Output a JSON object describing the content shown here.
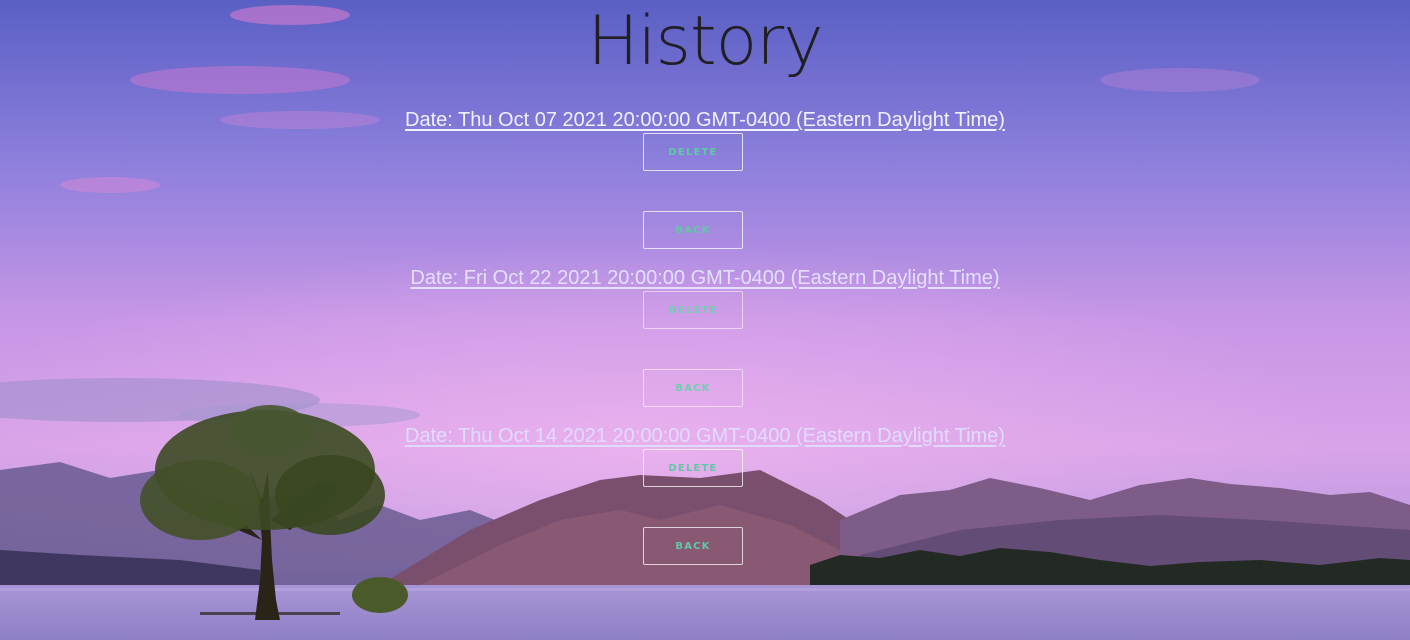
{
  "page": {
    "title": "History"
  },
  "entries": [
    {
      "date_text": "Date: Thu Oct 07 2021 20:00:00 GMT-0400 (Eastern Daylight Time)",
      "delete_label": "DELETE",
      "back_label": "BACK"
    },
    {
      "date_text": "Date: Fri Oct 22 2021 20:00:00 GMT-0400 (Eastern Daylight Time)",
      "delete_label": "DELETE",
      "back_label": "BACK"
    },
    {
      "date_text": "Date: Thu Oct 14 2021 20:00:00 GMT-0400 (Eastern Daylight Time)",
      "delete_label": "DELETE",
      "back_label": "BACK"
    }
  ],
  "colors": {
    "title": "#1f1f24",
    "link": "#f2f0ff",
    "button_text": "#5fc9a6",
    "button_border": "#ffffff"
  }
}
